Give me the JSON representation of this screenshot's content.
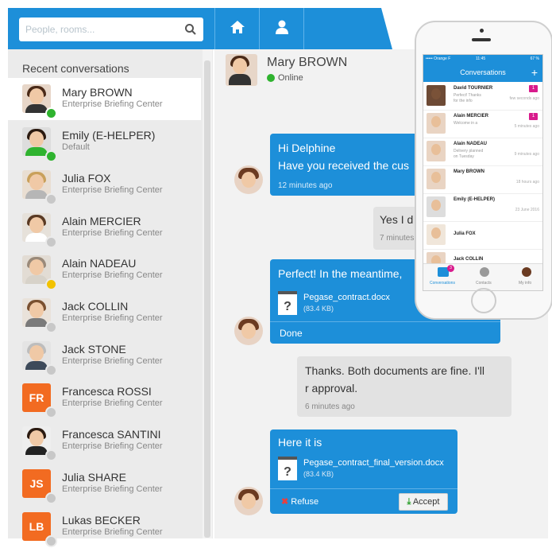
{
  "search": {
    "placeholder": "People, rooms..."
  },
  "left": {
    "header": "Recent conversations"
  },
  "conversations": [
    {
      "name": "Mary BROWN",
      "sub": "Enterprise Briefing Center",
      "status": "#2fb32f"
    },
    {
      "name": "Emily (E-HELPER)",
      "sub": "Default",
      "status": "#2fb32f"
    },
    {
      "name": "Julia FOX",
      "sub": "Enterprise Briefing Center",
      "status": "#c8c8c8"
    },
    {
      "name": "Alain MERCIER",
      "sub": "Enterprise Briefing Center",
      "status": "#c8c8c8"
    },
    {
      "name": "Alain NADEAU",
      "sub": "Enterprise Briefing Center",
      "status": "#f2c200"
    },
    {
      "name": "Jack COLLIN",
      "sub": "Enterprise Briefing Center",
      "status": "#c8c8c8"
    },
    {
      "name": "Jack STONE",
      "sub": "Enterprise Briefing Center",
      "status": "#c8c8c8"
    },
    {
      "name": "Francesca ROSSI",
      "sub": "Enterprise Briefing Center",
      "status": "#c8c8c8",
      "initials": "FR"
    },
    {
      "name": "Francesca SANTINI",
      "sub": "Enterprise Briefing Center",
      "status": "#c8c8c8"
    },
    {
      "name": "Julia SHARE",
      "sub": "Enterprise Briefing Center",
      "status": "#c8c8c8",
      "initials": "JS"
    },
    {
      "name": "Lukas BECKER",
      "sub": "Enterprise Briefing Center",
      "status": "#c8c8c8",
      "initials": "LB"
    }
  ],
  "chat": {
    "contact_name": "Mary BROWN",
    "contact_status": "Online",
    "messages": {
      "m1_line1": "Hi Delphine",
      "m1_line2": "Have you received the cus",
      "m1_time": "12 minutes ago",
      "m2_text": "Yes I d",
      "m2_time": "7 minutes",
      "m3_text": "Perfect! In the meantime, ",
      "m3_file": "Pegase_contract.docx",
      "m3_size": "(83.4 KB)",
      "m3_status": "Done",
      "m4_line1": "Thanks. Both documents are fine. I'll",
      "m4_line2": "r approval.",
      "m4_time": "6 minutes ago",
      "m5_text": "Here it is",
      "m5_file": "Pegase_contract_final_version.docx",
      "m5_size": "(83.4 KB)",
      "refuse": "Refuse",
      "accept": "Accept"
    }
  },
  "phone": {
    "carrier": "••••• Orange F",
    "clock": "11:45",
    "battery": "67 %",
    "title": "Conversations",
    "rows": [
      {
        "name": "David TOURNIER",
        "msg": "Perfect! Thanks",
        "msg2": "for the info",
        "time": "few seconds ago",
        "badge": "1"
      },
      {
        "name": "Alain MERCIER",
        "msg": "Welcome in a",
        "msg2": "",
        "time": "5 minutes ago",
        "badge": "1"
      },
      {
        "name": "Alain NADEAU",
        "msg": "Delivery planned",
        "msg2": "on Tuesday",
        "time": "9 minutes ago",
        "badge": ""
      },
      {
        "name": "Mary BROWN",
        "msg": "",
        "msg2": "",
        "time": "18 hours ago",
        "badge": ""
      },
      {
        "name": "Emily (E-HELPER)",
        "msg": "",
        "msg2": "",
        "time": "23 June 2016",
        "badge": ""
      },
      {
        "name": "Julia FOX",
        "msg": "",
        "msg2": "",
        "time": "",
        "badge": ""
      }
    ],
    "partial_row": "Jack COLLIN",
    "tabs": [
      "Conversations",
      "Contacts",
      "My info"
    ],
    "tab_badge": "3"
  }
}
